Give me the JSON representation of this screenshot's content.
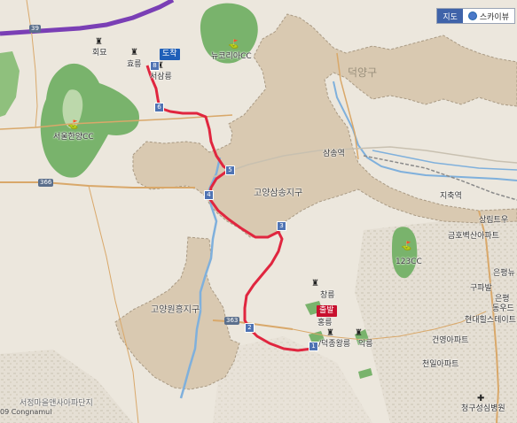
{
  "map_type_control": {
    "map_label": "지도",
    "skyview_label": "스카이뷰",
    "skyview_icon": "skyview-icon"
  },
  "route": {
    "start_label": "출발",
    "end_label": "도착",
    "start_color": "#c8102e",
    "end_color": "#1f5fb8",
    "line_color": "#e0263f",
    "waypoints": [
      "8",
      "6",
      "5",
      "4",
      "3",
      "2",
      "1"
    ]
  },
  "districts": [
    "고양삼송지구",
    "고양원흥지구"
  ],
  "places": {
    "hoeryong": "회묘",
    "hyoreung": "효릉",
    "seosamreung": "서삼릉",
    "new_korea_cc": "뉴코리아CC",
    "seoul_hanyang_cc": "서울한양CC",
    "samsong_station": "삼송역",
    "jichuk_station": "지축역",
    "sangrim_town": "상림트우",
    "geumho_apt": "금호벽산아파트",
    "cc_123": "123CC",
    "eunpyeong_town": "은평뉴",
    "gupabal": "구파발",
    "eunpyeong_area": "은평",
    "eunpyeong_dong": "동우드",
    "hyundai_apt": "현대힐스테이트",
    "changreung": "창릉",
    "hongreung": "홍릉",
    "deokjong": "/덕종왕릉",
    "ikreung": "익릉",
    "geonyeong_apt": "건영아파트",
    "cheonil_apt": "천일아파트",
    "cheonggu_hospital": "청구성심병원",
    "seojeong_cemetery": "서정마을앤사아파단지",
    "dukyang_gu": "덕양구"
  },
  "road_shields": [
    "39",
    "366",
    "363"
  ],
  "copyright": "09 Congnamul",
  "colors": {
    "land": "#ece7dd",
    "district_fill": "#d9c9b1",
    "district_stroke": "#a99a84",
    "green": "#79b36c",
    "water": "#7fb0dc",
    "highway": "#7a3fb5",
    "road": "#d9a86a"
  }
}
